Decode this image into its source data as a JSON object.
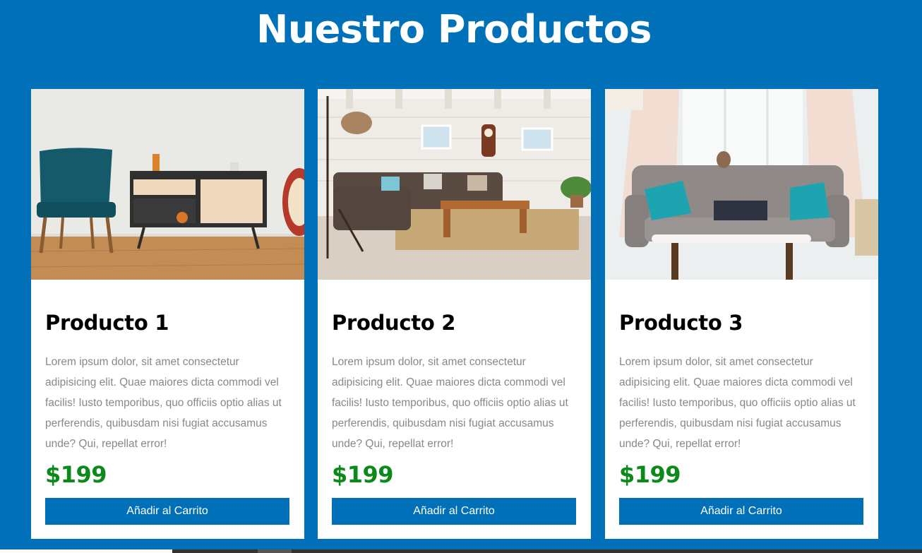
{
  "page": {
    "title": "Nuestro Productos",
    "background_color": "#0070b8"
  },
  "products": [
    {
      "name": "Producto 1",
      "description": "Lorem ipsum dolor, sit amet consectetur adipisicing elit. Quae maiores dicta commodi vel facilis! Iusto temporibus, quo officiis optio alias ut perferendis, quibusdam nisi fugiat accusamus unde? Qui, repellat error!",
      "price": "$199",
      "button_label": "Añadir al Carrito",
      "image": "sideboard-armchair-photo"
    },
    {
      "name": "Producto 2",
      "description": "Lorem ipsum dolor, sit amet consectetur adipisicing elit. Quae maiores dicta commodi vel facilis! Iusto temporibus, quo officiis optio alias ut perferendis, quibusdam nisi fugiat accusamus unde? Qui, repellat error!",
      "price": "$199",
      "button_label": "Añadir al Carrito",
      "image": "living-room-sofa-photo"
    },
    {
      "name": "Producto 3",
      "description": "Lorem ipsum dolor, sit amet consectetur adipisicing elit. Quae maiores dicta commodi vel facilis! Iusto temporibus, quo officiis optio alias ut perferendis, quibusdam nisi fugiat accusamus unde? Qui, repellat error!",
      "price": "$199",
      "button_label": "Añadir al Carrito",
      "image": "grey-sofa-cushions-photo"
    }
  ],
  "colors": {
    "accent": "#0070b8",
    "price": "#0b8a1a",
    "card": "#ffffff",
    "description_text": "#888888"
  }
}
